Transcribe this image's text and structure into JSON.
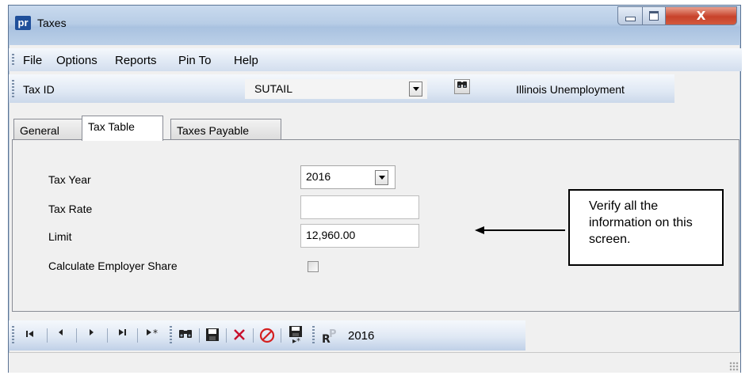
{
  "window": {
    "app_icon_text": "pr",
    "title": "Taxes",
    "controls": {
      "minimize": "minimize-icon",
      "maximize": "maximize-icon",
      "close": "close-icon"
    }
  },
  "menu": {
    "items": [
      "File",
      "Options",
      "Reports",
      "Pin To",
      "Help"
    ]
  },
  "taxid": {
    "label": "Tax ID",
    "value": "SUTAIL",
    "description": "Illinois Unemployment",
    "find_icon": "binoculars-icon"
  },
  "tabs": [
    {
      "label": "General",
      "active": false
    },
    {
      "label": "Tax Table",
      "active": true
    },
    {
      "label": "Taxes Payable",
      "active": false
    }
  ],
  "form": {
    "tax_year_label": "Tax Year",
    "tax_year_value": "2016",
    "tax_rate_label": "Tax Rate",
    "tax_rate_value": "",
    "limit_label": "Limit",
    "limit_value": "12,960.00",
    "employer_share_label": "Calculate Employer Share",
    "employer_share_checked": false
  },
  "callout": {
    "text": "Verify all the information on this screen."
  },
  "navbar": {
    "buttons": [
      "first-record-icon",
      "previous-record-icon",
      "next-record-icon",
      "last-record-icon",
      "new-record-icon",
      "binoculars-icon",
      "save-icon",
      "delete-icon",
      "cancel-icon",
      "save-and-new-icon",
      "report-icon"
    ],
    "year": "2016"
  },
  "colors": {
    "title_bar": "#b8cde6",
    "close_button": "#c7422a",
    "delete_icon": "#c8102e",
    "cancel_icon": "#d42020",
    "app_icon": "#1f4f9a"
  }
}
